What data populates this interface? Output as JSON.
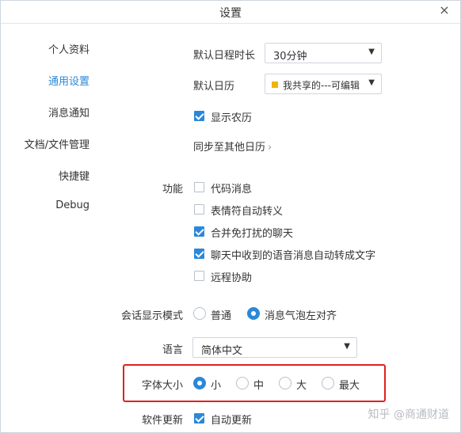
{
  "window": {
    "title": "设置",
    "close_glyph": "×"
  },
  "sidebar": {
    "items": [
      {
        "label": "个人资料"
      },
      {
        "label": "通用设置"
      },
      {
        "label": "消息通知"
      },
      {
        "label": "文档/文件管理"
      },
      {
        "label": "快捷键"
      },
      {
        "label": "Debug"
      }
    ],
    "active_index": 1
  },
  "calendar": {
    "duration_label": "默认日程时长",
    "duration_value": "30分钟",
    "default_calendar_label": "默认日历",
    "default_calendar_value": "我共享的---可编辑",
    "default_calendar_color": "#f1b400",
    "show_lunar_label": "显示农历",
    "show_lunar_checked": true,
    "sync_label": "同步至其他日历",
    "sync_chevron": "›"
  },
  "features": {
    "section_label": "功能",
    "options": [
      {
        "label": "代码消息",
        "checked": false
      },
      {
        "label": "表情符自动转义",
        "checked": false
      },
      {
        "label": "合并免打扰的聊天",
        "checked": true
      },
      {
        "label": "聊天中收到的语音消息自动转成文字",
        "checked": true
      },
      {
        "label": "远程协助",
        "checked": false
      }
    ]
  },
  "session_mode": {
    "label": "会话显示模式",
    "options": [
      {
        "label": "普通",
        "checked": false
      },
      {
        "label": "消息气泡左对齐",
        "checked": true
      }
    ]
  },
  "language": {
    "label": "语言",
    "value": "简体中文"
  },
  "font_size": {
    "label": "字体大小",
    "options": [
      {
        "label": "小",
        "checked": true
      },
      {
        "label": "中",
        "checked": false
      },
      {
        "label": "大",
        "checked": false
      },
      {
        "label": "最大",
        "checked": false
      }
    ]
  },
  "software_update": {
    "label": "软件更新",
    "auto_update_label": "自动更新",
    "auto_update_checked": true
  },
  "watermark": {
    "text": "知乎 @商通财道"
  },
  "colors": {
    "accent": "#2b88d8",
    "highlight": "#e02020"
  }
}
